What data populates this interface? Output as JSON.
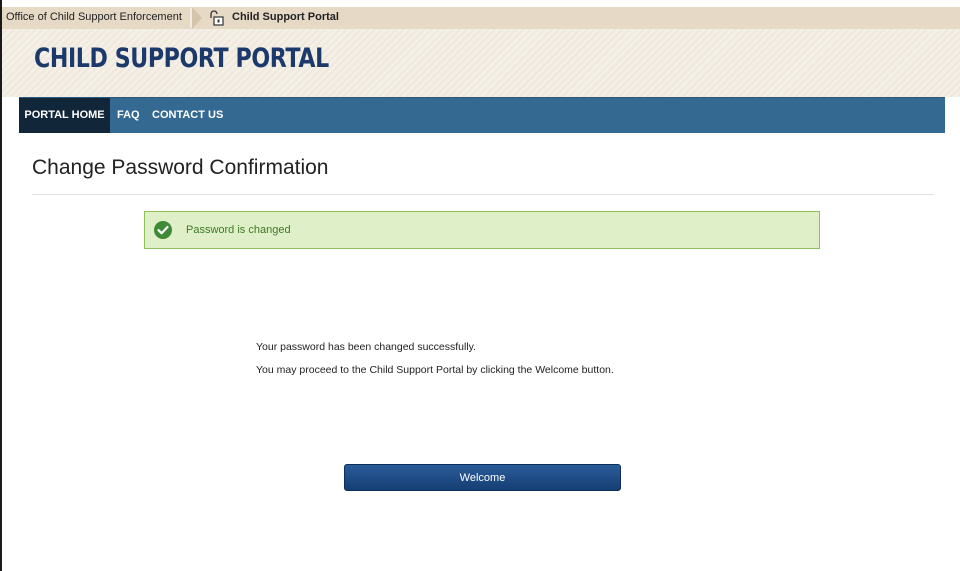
{
  "breadcrumb": {
    "parent": "Office of Child Support Enforcement",
    "current": "Child Support Portal"
  },
  "header": {
    "logo_text": "CHILD SUPPORT PORTAL"
  },
  "nav": {
    "items": [
      {
        "label": "PORTAL HOME",
        "active": true
      },
      {
        "label": "FAQ",
        "active": false
      },
      {
        "label": "CONTACT US",
        "active": false
      }
    ]
  },
  "page": {
    "title": "Change Password Confirmation"
  },
  "alert": {
    "text": "Password is changed",
    "icon": "check-circle-icon",
    "status_color": "#3e8a36"
  },
  "message": {
    "line1": "Your password has been changed successfully.",
    "line2": "You may proceed to the Child Support Portal by clicking the Welcome button."
  },
  "actions": {
    "welcome_label": "Welcome"
  },
  "colors": {
    "nav": "#346a92",
    "nav_active": "#12263a",
    "brand": "#1b3a6b"
  }
}
